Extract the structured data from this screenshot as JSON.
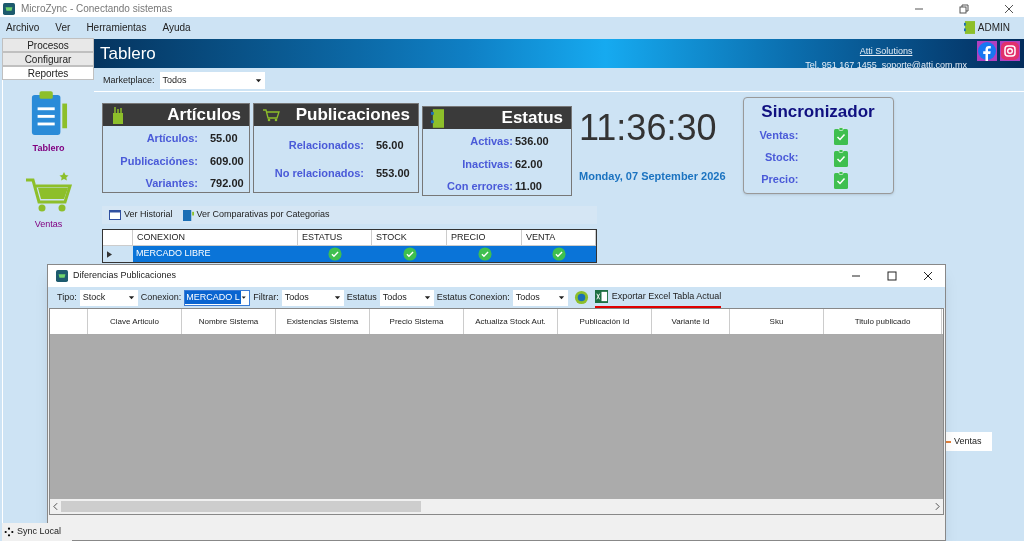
{
  "window": {
    "title": "MicroZync - Conectando sistemas"
  },
  "menu": [
    "Archivo",
    "Ver",
    "Herramientas",
    "Ayuda"
  ],
  "user": "ADMIN",
  "sidebar": {
    "tabs": [
      {
        "label": "Procesos",
        "selected": false
      },
      {
        "label": "Configurar",
        "selected": false
      },
      {
        "label": "Reportes",
        "selected": true
      }
    ],
    "items": [
      {
        "label": "Tablero",
        "selected": true
      },
      {
        "label": "Ventas",
        "selected": false
      }
    ]
  },
  "header": {
    "title": "Tablero",
    "company": "Atti Solutions",
    "contact": "Tel. 951 167 1455  soporte@atti.com.mx"
  },
  "marketplace": {
    "label": "Marketplace:",
    "value": "Todos"
  },
  "cards": [
    {
      "title": "Artículos",
      "rows": [
        {
          "label": "Artículos:",
          "value": "55.00"
        },
        {
          "label": "Publicaciónes:",
          "value": "609.00"
        },
        {
          "label": "Variantes:",
          "value": "792.00"
        }
      ]
    },
    {
      "title": "Publicaciones",
      "rows": [
        {
          "label": "Relacionados:",
          "value": "56.00"
        },
        {
          "label": "No relacionados:",
          "value": "553.00"
        }
      ]
    },
    {
      "title": "Estatus",
      "rows": [
        {
          "label": "Activas:",
          "value": "536.00"
        },
        {
          "label": "Inactivas:",
          "value": "62.00"
        },
        {
          "label": "Con errores:",
          "value": "11.00"
        }
      ]
    }
  ],
  "clock": {
    "time": "11:36:30",
    "date": "Monday, 07 September 2026"
  },
  "sync": {
    "title": "Sincronizador",
    "rows": [
      {
        "label": "Ventas:",
        "ok": true
      },
      {
        "label": "Stock:",
        "ok": true
      },
      {
        "label": "Precio:",
        "ok": true
      }
    ]
  },
  "toolbar": [
    "Ver Historial",
    "Ver Comparativas por Categorias"
  ],
  "table": {
    "columns": [
      "CONEXION",
      "ESTATUS",
      "STOCK",
      "PRECIO",
      "VENTA"
    ],
    "rows": [
      {
        "conexion": "MERCADO LIBRE",
        "selected": true,
        "ok": [
          true,
          true,
          true,
          true
        ]
      }
    ]
  },
  "legend": "Ventas",
  "status_bar": {
    "sync": "Sync Local"
  },
  "dialog": {
    "title": "Diferencias Publicaciones",
    "filters": [
      {
        "label": "Tipo:",
        "value": "Stock",
        "focused": false
      },
      {
        "label": "Conexion:",
        "value": "MERCADO L",
        "focused": true
      },
      {
        "label": "Filtrar:",
        "value": "Todos",
        "focused": false
      },
      {
        "label": "Estatus",
        "value": "Todos",
        "focused": false
      },
      {
        "label": "Estatus Conexion:",
        "value": "Todos",
        "focused": false
      }
    ],
    "export": "Exportar Excel Tabla Actual",
    "columns": [
      "Clave Articulo",
      "Nombre Sistema",
      "Existencias Sistema",
      "Precio Sistema",
      "Actualiza Stock Aut.",
      "Publicación Id",
      "Variante Id",
      "Sku",
      "Titulo publicado"
    ]
  }
}
